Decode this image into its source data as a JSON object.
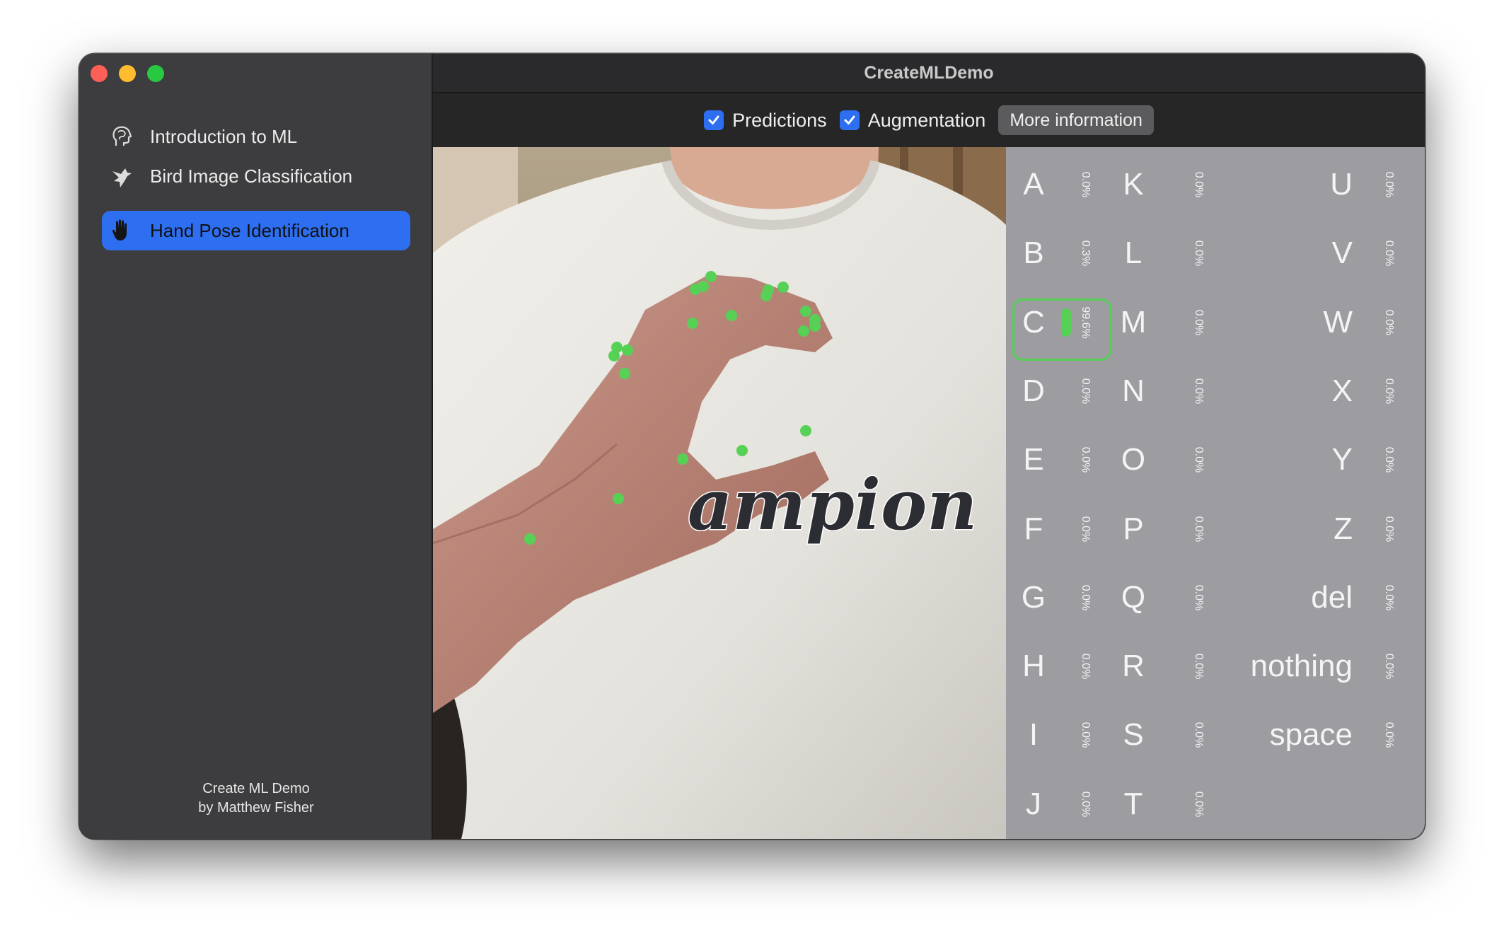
{
  "window": {
    "title": "CreateMLDemo"
  },
  "sidebar": {
    "items": [
      {
        "label": "Introduction to ML",
        "icon": "brain-head-icon"
      },
      {
        "label": "Bird Image Classification",
        "icon": "bird-icon"
      },
      {
        "label": "Hand Pose Identification",
        "icon": "hand-icon",
        "selected": true
      }
    ],
    "footer_line1": "Create ML Demo",
    "footer_line2": "by Matthew Fisher"
  },
  "toolbar": {
    "predictions_label": "Predictions",
    "predictions_checked": true,
    "augmentation_label": "Augmentation",
    "augmentation_checked": true,
    "info_button_label": "More information"
  },
  "camera": {
    "shirt_logo_text": "ampion",
    "keypoint_color": "#56d156"
  },
  "predictions": {
    "top": "C",
    "classes": [
      {
        "label": "A",
        "pct": "0.0%",
        "value": 0.0
      },
      {
        "label": "B",
        "pct": "0.3%",
        "value": 0.003
      },
      {
        "label": "C",
        "pct": "99.6%",
        "value": 0.996
      },
      {
        "label": "D",
        "pct": "0.0%",
        "value": 0.0
      },
      {
        "label": "E",
        "pct": "0.0%",
        "value": 0.0
      },
      {
        "label": "F",
        "pct": "0.0%",
        "value": 0.0
      },
      {
        "label": "G",
        "pct": "0.0%",
        "value": 0.0
      },
      {
        "label": "H",
        "pct": "0.0%",
        "value": 0.0
      },
      {
        "label": "I",
        "pct": "0.0%",
        "value": 0.0
      },
      {
        "label": "J",
        "pct": "0.0%",
        "value": 0.0
      },
      {
        "label": "K",
        "pct": "0.0%",
        "value": 0.0
      },
      {
        "label": "L",
        "pct": "0.0%",
        "value": 0.0
      },
      {
        "label": "M",
        "pct": "0.0%",
        "value": 0.0
      },
      {
        "label": "N",
        "pct": "0.0%",
        "value": 0.0
      },
      {
        "label": "O",
        "pct": "0.0%",
        "value": 0.0
      },
      {
        "label": "P",
        "pct": "0.0%",
        "value": 0.0
      },
      {
        "label": "Q",
        "pct": "0.0%",
        "value": 0.0
      },
      {
        "label": "R",
        "pct": "0.0%",
        "value": 0.0
      },
      {
        "label": "S",
        "pct": "0.0%",
        "value": 0.0
      },
      {
        "label": "T",
        "pct": "0.0%",
        "value": 0.0
      },
      {
        "label": "U",
        "pct": "0.0%",
        "value": 0.0
      },
      {
        "label": "V",
        "pct": "0.0%",
        "value": 0.0
      },
      {
        "label": "W",
        "pct": "0.0%",
        "value": 0.0
      },
      {
        "label": "X",
        "pct": "0.0%",
        "value": 0.0
      },
      {
        "label": "Y",
        "pct": "0.0%",
        "value": 0.0
      },
      {
        "label": "Z",
        "pct": "0.0%",
        "value": 0.0
      },
      {
        "label": "del",
        "pct": "0.0%",
        "value": 0.0
      },
      {
        "label": "nothing",
        "pct": "0.0%",
        "value": 0.0
      },
      {
        "label": "space",
        "pct": "0.0%",
        "value": 0.0
      }
    ]
  },
  "colors": {
    "accent": "#2e6ff1",
    "prediction_highlight": "#56d156",
    "sidebar_bg": "#3d3d3f",
    "grid_bg": "#9c9ca1"
  }
}
